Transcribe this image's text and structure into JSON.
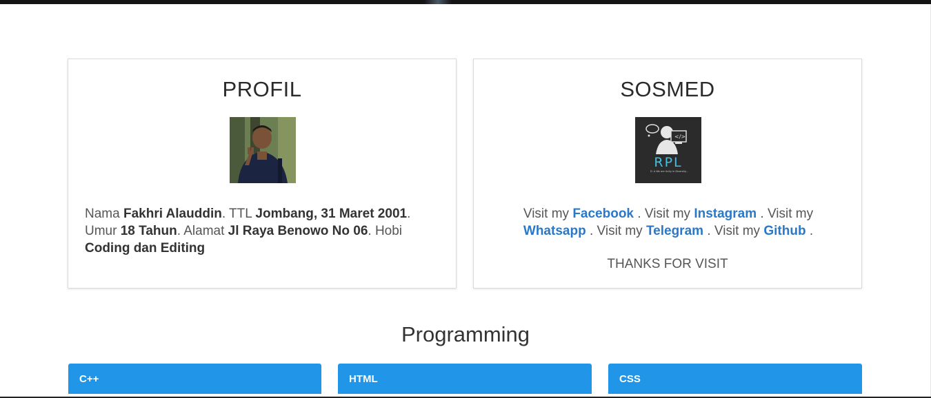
{
  "profil": {
    "title": "PROFIL",
    "nama_label": "Nama ",
    "nama": "Fakhri Alauddin",
    "ttl_label": ". TTL ",
    "ttl": "Jombang, 31 Maret 2001",
    "umur_label": ". Umur ",
    "umur": "18 Tahun",
    "alamat_label": ". Alamat ",
    "alamat": "Jl Raya Benowo No 06",
    "hobi_label": ". Hobi ",
    "hobi": "Coding dan Editing"
  },
  "sosmed": {
    "title": "SOSMED",
    "visit_label": "Visit my",
    "links": [
      "Facebook",
      "Instagram",
      "Whatsapp",
      "Telegram",
      "Github"
    ],
    "thanks": "THANKS FOR VISIT",
    "logo_text": "RPL",
    "logo_tagline": "D. A We are Unity in Diversity..."
  },
  "programming": {
    "title": "Programming",
    "cards": [
      "C++",
      "HTML",
      "CSS"
    ]
  },
  "colors": {
    "link": "#2a78c8",
    "card_header": "#2196e8",
    "logo_bg": "#2b2b2b",
    "logo_accent": "#3cc4e6"
  }
}
